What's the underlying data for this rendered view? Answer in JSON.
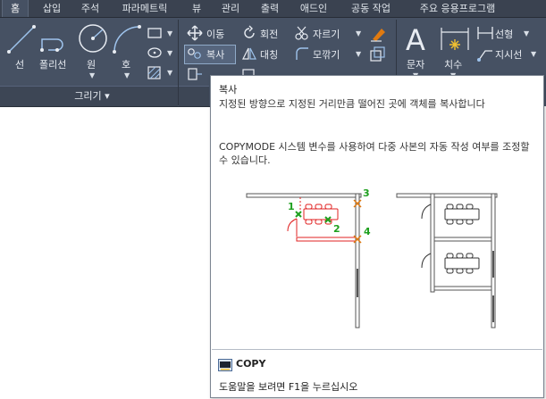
{
  "tabs": [
    "홈",
    "삽입",
    "주석",
    "파라메트릭",
    "뷰",
    "관리",
    "출력",
    "애드인",
    "공동 작업",
    "주요 응용프로그램"
  ],
  "ribbon": {
    "draw": {
      "line": "선",
      "polyline": "폴리선",
      "circle": "원",
      "arc": "호",
      "panel_label": "그리기 ▾"
    },
    "modify": {
      "move": "이동",
      "rotate": "회전",
      "trim": "자르기",
      "copy": "복사",
      "mirror": "대칭",
      "fillet": "모깎기"
    },
    "annotation": {
      "text": "문자",
      "dimension": "치수",
      "linear": "선형",
      "leader": "지시선"
    }
  },
  "tooltip": {
    "title": "복사",
    "description_1": "지정된 방향으로 지정된 거리만큼 떨어진 곳에 객체를 복사합니다",
    "description_2": "COPYMODE 시스템 변수를 사용하여 다중 사본의 자동 작성 여부를 조정할 수 있습니다.",
    "diagram_labels": [
      "1",
      "2",
      "3",
      "4"
    ],
    "command": "COPY",
    "help": "도움말을 보려면 F1을 누르십시오"
  },
  "colors": {
    "ribbon_bg": "#465163",
    "tab_bg": "#3a4250",
    "accent_green": "#1fa01f",
    "accent_red": "#e02020",
    "accent_orange": "#e07a10"
  }
}
